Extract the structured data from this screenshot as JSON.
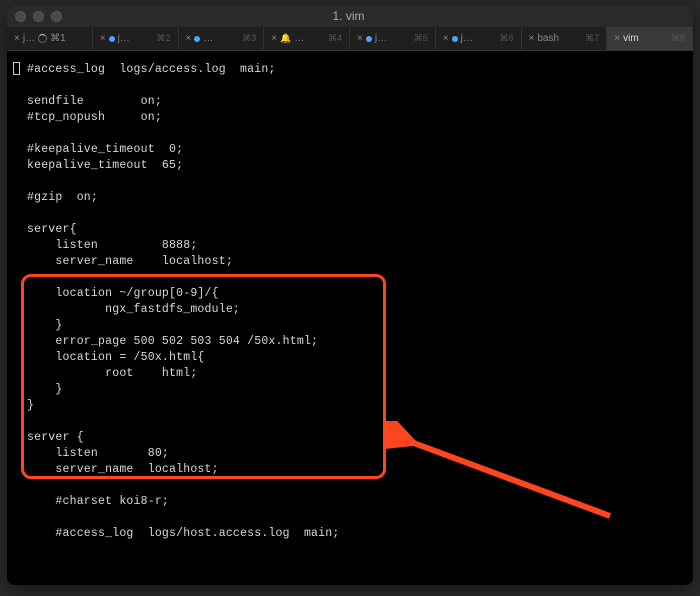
{
  "window": {
    "title": "1. vim"
  },
  "tabs": [
    {
      "icon": "spinner",
      "label": "⌘1",
      "shortcut": "",
      "pref": "j…",
      "active": false
    },
    {
      "icon": "bluedot",
      "label": "j…",
      "shortcut": "⌘2",
      "active": false
    },
    {
      "icon": "bluedot",
      "label": "…",
      "shortcut": "⌘3",
      "active": false
    },
    {
      "icon": "bell",
      "label": "…",
      "shortcut": "⌘4",
      "active": false
    },
    {
      "icon": "bluedot",
      "label": "j…",
      "shortcut": "⌘5",
      "active": false
    },
    {
      "icon": "bluedot",
      "label": "j…",
      "shortcut": "⌘6",
      "active": false
    },
    {
      "icon": "none",
      "label": "bash",
      "shortcut": "⌘7",
      "active": false
    },
    {
      "icon": "none",
      "label": "vim",
      "shortcut": "⌘8",
      "active": true
    }
  ],
  "code": {
    "lines": [
      "#access_log  logs/access.log  main;",
      "",
      "sendfile        on;",
      "#tcp_nopush     on;",
      "",
      "#keepalive_timeout  0;",
      "keepalive_timeout  65;",
      "",
      "#gzip  on;",
      "",
      "server{",
      "    listen         8888;",
      "    server_name    localhost;",
      "",
      "    location ~/group[0-9]/{",
      "           ngx_fastdfs_module;",
      "    }",
      "    error_page 500 502 503 504 /50x.html;",
      "    location = /50x.html{",
      "           root    html;",
      "    }",
      "}",
      "",
      "server {",
      "    listen       80;",
      "    server_name  localhost;",
      "",
      "    #charset koi8-r;",
      "",
      "    #access_log  logs/host.access.log  main;"
    ]
  }
}
